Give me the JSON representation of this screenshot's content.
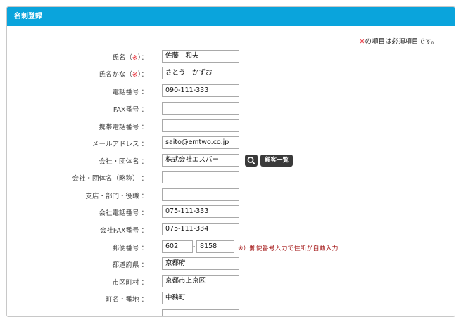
{
  "panel": {
    "title": "名刺登録"
  },
  "required_note": {
    "mark": "※",
    "text": "の項目は必須項目です。"
  },
  "fields": [
    {
      "label_pre": "氏名（",
      "req": "※",
      "label_post": "）：",
      "value": "佐藤　和夫"
    },
    {
      "label_pre": "氏名かな（",
      "req": "※",
      "label_post": "）：",
      "value": "さとう　かずお"
    },
    {
      "label": "電話番号 ：",
      "value": "090-111-333"
    },
    {
      "label": "FAX番号 ：",
      "value": ""
    },
    {
      "label": "携帯電話番号 ：",
      "value": ""
    },
    {
      "label": "メールアドレス ：",
      "value": "saito@emtwo.co.jp"
    },
    {
      "label": "会社・団体名 ：",
      "value": "株式会社エスバー"
    },
    {
      "label": "会社・団体名（略称） ：",
      "value": ""
    },
    {
      "label": "支店・部門・役職 ：",
      "value": ""
    },
    {
      "label": "会社電話番号 ：",
      "value": "075-111-333"
    },
    {
      "label": "会社FAX番号 ：",
      "value": "075-111-334"
    },
    {
      "label": "郵便番号 ：",
      "zip1": "602",
      "zip2": "8158",
      "note": "※）郵便番号入力で住所が自動入力"
    },
    {
      "label": "都道府県 ：",
      "value": "京都府"
    },
    {
      "label": "市区町村 ：",
      "value": "京都市上京区"
    },
    {
      "label": "町名・番地 ：",
      "value": "中務町"
    }
  ],
  "buttons": {
    "search_icon": "search-icon",
    "customer_list": "顧客一覧"
  },
  "colors": {
    "header": "#0aa4dc",
    "required": "#e8323c",
    "note": "#a31515",
    "button": "#3a3a3a"
  }
}
